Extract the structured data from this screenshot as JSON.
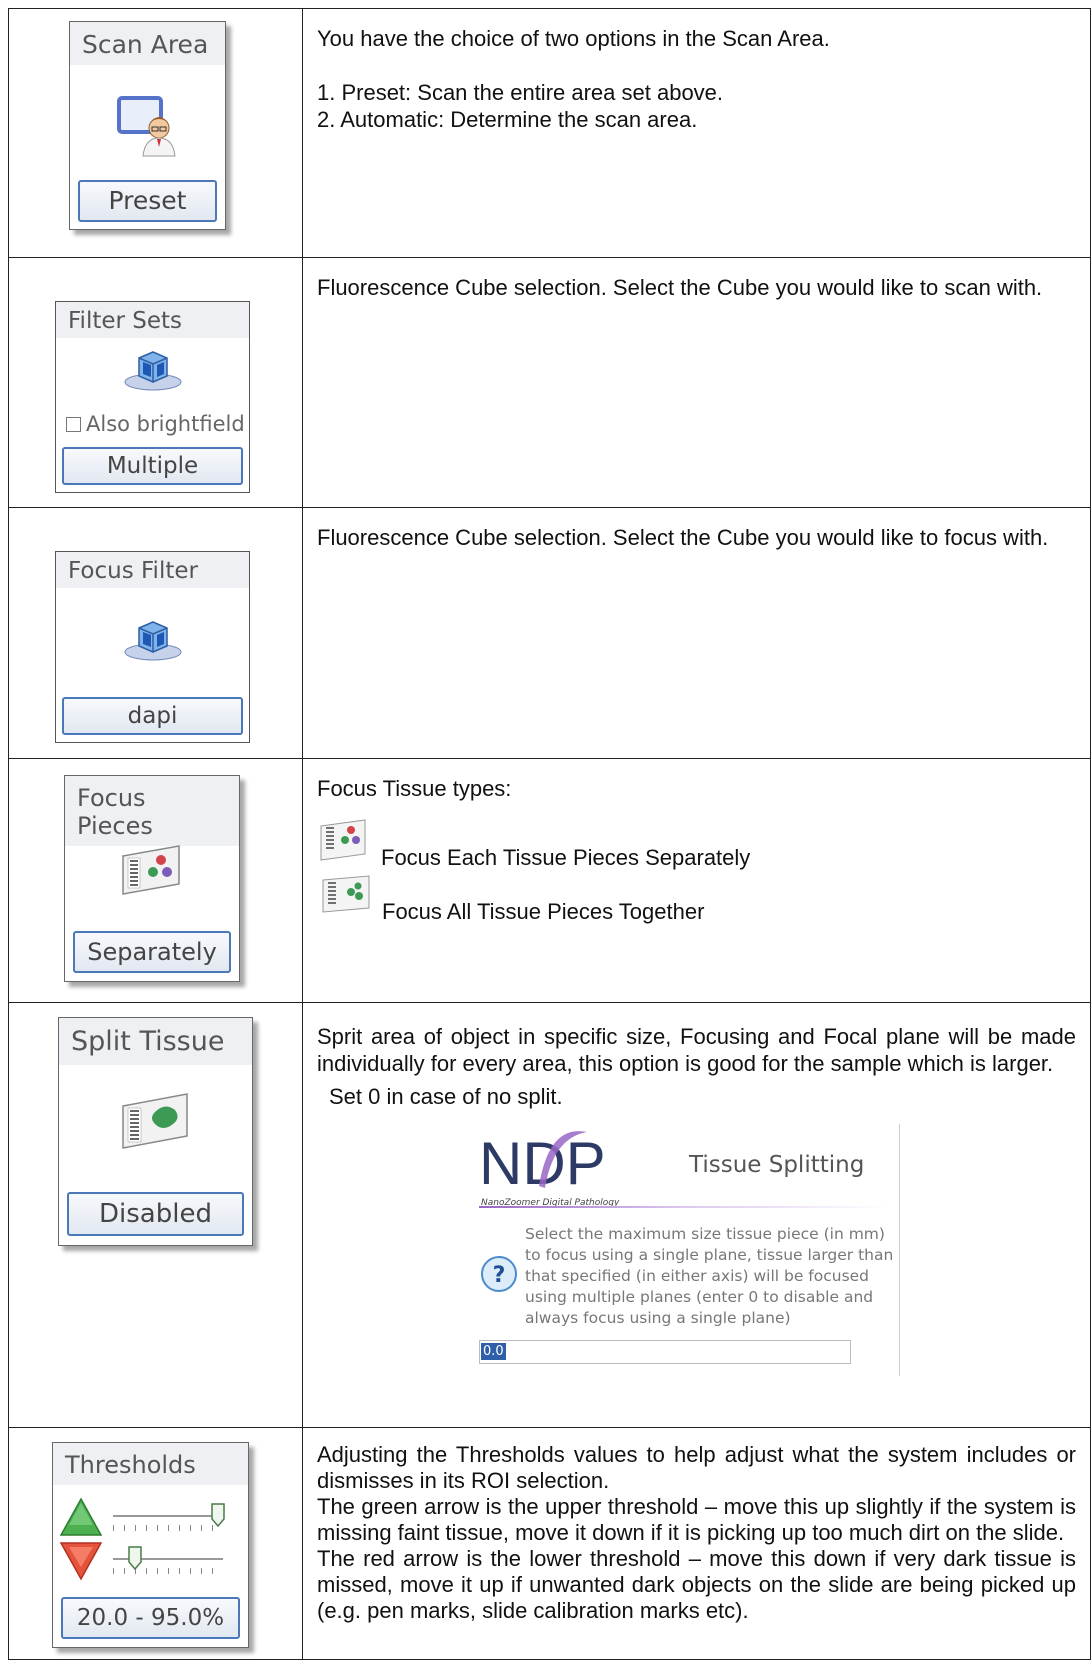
{
  "rows": {
    "scan_area": {
      "panel_title": "Scan Area",
      "button": "Preset",
      "icon": "monitor-with-user-icon",
      "desc_intro": "You have the choice of two options in the Scan Area.",
      "option1": "1. Preset: Scan the entire area set above.",
      "option2": "2. Automatic: Determine the scan area."
    },
    "filter_sets": {
      "panel_title": "Filter Sets",
      "checkbox_label": "Also brightfield",
      "checkbox_checked": false,
      "button": "Multiple",
      "icon": "filter-cube-icon",
      "desc": "Fluorescence Cube selection. Select the Cube you would like to scan with."
    },
    "focus_filter": {
      "panel_title": "Focus Filter",
      "button": "dapi",
      "icon": "filter-cube-icon",
      "desc": "Fluorescence Cube selection. Select the Cube you would like to focus with."
    },
    "focus_pieces": {
      "panel_title": "Focus Pieces",
      "button": "Separately",
      "icon": "tissue-slide-icon",
      "desc_title": "Focus Tissue types:",
      "option_separate": "Focus Each Tissue Pieces Separately",
      "option_together": "Focus All Tissue Pieces Together"
    },
    "split_tissue": {
      "panel_title": "Split Tissue",
      "button": "Disabled",
      "icon": "tissue-slide-icon",
      "desc": "Sprit area of object in specific size, Focusing and Focal plane will be made individually for every area, this option is good for the sample which is larger.",
      "note": "Set 0 in case of no split.",
      "dialog": {
        "logo": "NDP",
        "logo_sub": "NanoZoomer Digital Pathology",
        "title": "Tissue Splitting",
        "help": "Select the maximum size tissue piece (in mm) to focus using a single plane, tissue larger than that specified (in either axis) will be focused using multiple planes (enter 0 to disable and always focus using a single plane)",
        "value": "0.0"
      }
    },
    "thresholds": {
      "panel_title": "Thresholds",
      "value": "20.0 - 95.0%",
      "upper_level": 0.95,
      "lower_level": 0.2,
      "desc1": "Adjusting the Thresholds values to help adjust what the system includes or dismisses in its ROI selection.",
      "desc2": "The green arrow is the upper threshold – move this up slightly if the system is missing faint tissue, move it down if it is picking up too much dirt on the slide.",
      "desc3": "The red arrow is the lower threshold – move this down if very dark tissue is missed, move it up if unwanted dark objects on the slide are being picked up (e.g. pen marks, slide calibration marks etc)."
    }
  }
}
